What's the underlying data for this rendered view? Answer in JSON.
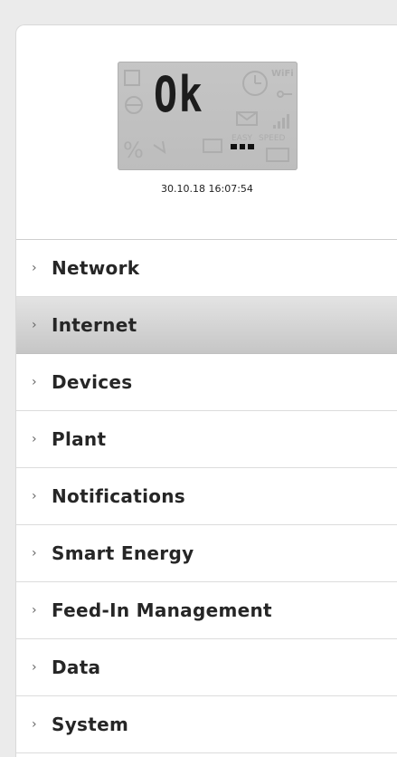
{
  "display": {
    "lcd_text": "Ok",
    "timestamp": "30.10.18 16:07:54",
    "ghost_labels": [
      "WiFi",
      "EASY",
      "SPEED",
      "%"
    ]
  },
  "menu": {
    "chevron": "›",
    "active_index": 1,
    "items": [
      {
        "label": "Network"
      },
      {
        "label": "Internet"
      },
      {
        "label": "Devices"
      },
      {
        "label": "Plant"
      },
      {
        "label": "Notifications"
      },
      {
        "label": "Smart Energy"
      },
      {
        "label": "Feed-In Management"
      },
      {
        "label": "Data"
      },
      {
        "label": "System"
      }
    ]
  },
  "colors": {
    "page_background": "#ebebeb",
    "panel_background": "#ffffff",
    "active_item_top": "#e3e3e3",
    "active_item_bottom": "#c6c6c6",
    "lcd_background": "#c2c2c2"
  }
}
